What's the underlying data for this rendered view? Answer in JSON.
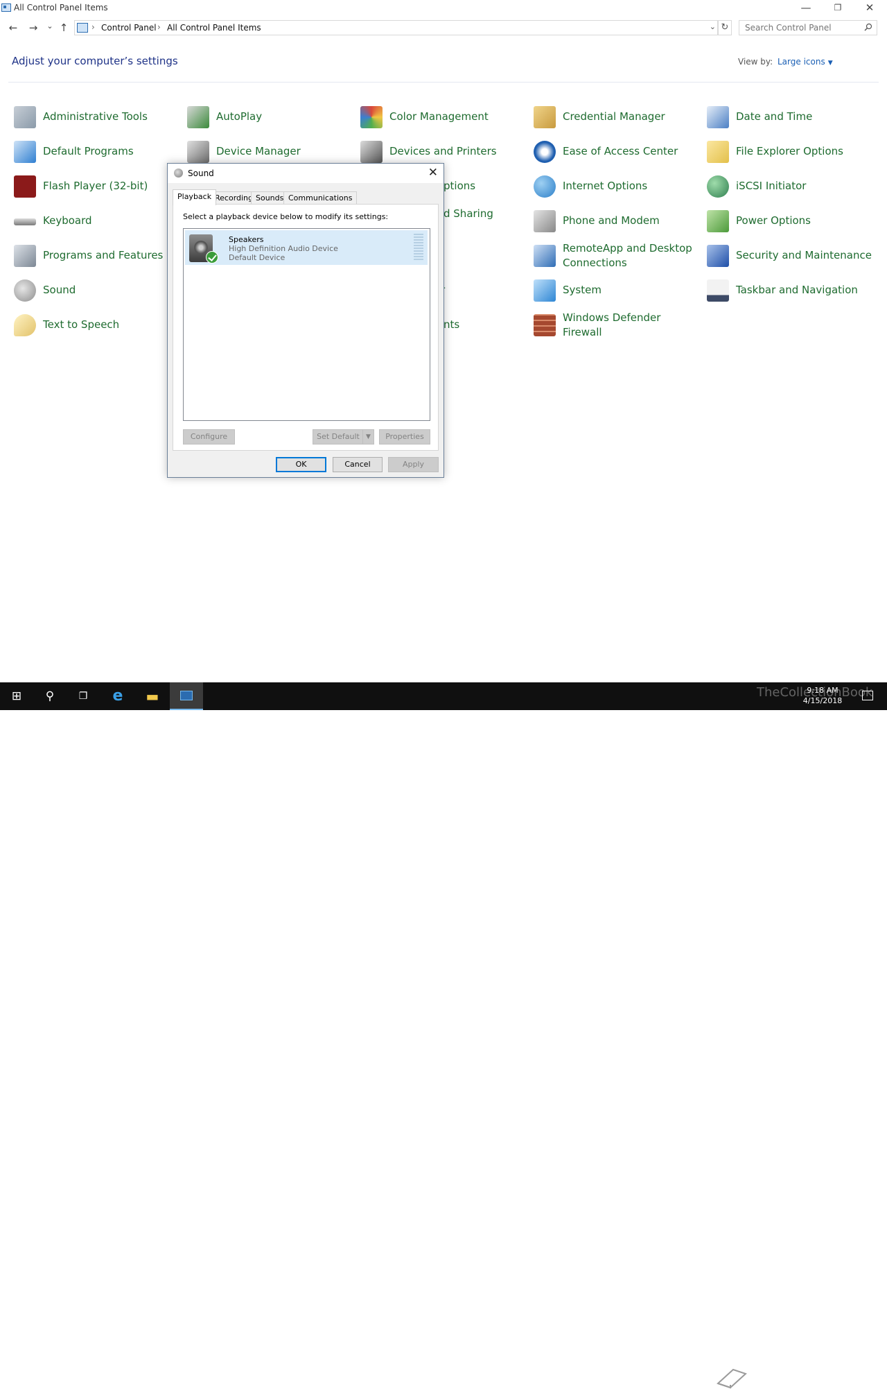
{
  "window": {
    "title": "All Control Panel Items",
    "minimize_glyph": "—",
    "restore_glyph": "❐",
    "close_glyph": "✕"
  },
  "nav": {
    "back_glyph": "←",
    "forward_glyph": "→",
    "recent_glyph": "⌄",
    "up_glyph": "↑",
    "breadcrumb": [
      "Control Panel",
      "All Control Panel Items"
    ],
    "sep_glyph": "›",
    "refresh_glyph": "↻",
    "dropdown_glyph": "⌄"
  },
  "search": {
    "placeholder": "Search Control Panel",
    "icon": "search-icon"
  },
  "header": {
    "title": "Adjust your computer’s settings",
    "view_by_label": "View by:",
    "view_by_value": "Large icons",
    "caret": "▼"
  },
  "items": [
    {
      "label": "Administrative Tools",
      "icon": "admin-tools-icon",
      "color": "#8a9aa9"
    },
    {
      "label": "AutoPlay",
      "icon": "autoplay-icon",
      "color": "#3b8a3b"
    },
    {
      "label": "Color Management",
      "icon": "color-management-icon",
      "color": "#c2553f"
    },
    {
      "label": "Credential Manager",
      "icon": "credential-manager-icon",
      "color": "#c89a3e"
    },
    {
      "label": "Date and Time",
      "icon": "date-time-icon",
      "color": "#4b7fc4"
    },
    {
      "label": "Default Programs",
      "icon": "default-programs-icon",
      "color": "#2f7fd1"
    },
    {
      "label": "Device Manager",
      "icon": "device-manager-icon",
      "color": "#6c6c6c"
    },
    {
      "label": "Devices and Printers",
      "icon": "devices-printers-icon",
      "color": "#555555"
    },
    {
      "label": "Ease of Access Center",
      "icon": "ease-of-access-icon",
      "color": "#1f5fb0"
    },
    {
      "label": "File Explorer Options",
      "icon": "file-explorer-options-icon",
      "color": "#e3c04a"
    },
    {
      "label": "Flash Player (32-bit)",
      "icon": "flash-player-icon",
      "color": "#8b1a1a"
    },
    {
      "label": "ptions",
      "icon": "",
      "color": ""
    },
    {
      "label": "Internet Options",
      "icon": "internet-options-icon",
      "color": "#2c7fc9"
    },
    {
      "label": "iSCSI Initiator",
      "icon": "iscsi-initiator-icon",
      "color": "#2f7f4f"
    },
    {
      "label": "Keyboard",
      "icon": "keyboard-icon",
      "color": "#7a7a7a"
    },
    {
      "label": "d Sharing",
      "icon": "",
      "color": ""
    },
    {
      "label": "Phone and Modem",
      "icon": "phone-modem-icon",
      "color": "#888888"
    },
    {
      "label": "Power Options",
      "icon": "power-options-icon",
      "color": "#4c9a3a"
    },
    {
      "label": "Programs and Features",
      "icon": "programs-features-icon",
      "color": "#7c8794"
    },
    {
      "label": "RemoteApp and Desktop Connections",
      "icon": "remoteapp-icon",
      "color": "#2f6db5"
    },
    {
      "label": "Security and Maintenance",
      "icon": "security-maintenance-icon",
      "color": "#1f4fa8"
    },
    {
      "label": "Sound",
      "icon": "sound-icon",
      "color": "#8c8c8c"
    },
    {
      "label": "r",
      "icon": "",
      "color": ""
    },
    {
      "label": "System",
      "icon": "system-icon",
      "color": "#2e86d4"
    },
    {
      "label": "Taskbar and Navigation",
      "icon": "taskbar-navigation-icon",
      "color": "#3d4a66"
    },
    {
      "label": "Text to Speech",
      "icon": "text-to-speech-icon",
      "color": "#e2c26a"
    },
    {
      "label": "nts",
      "icon": "",
      "color": ""
    },
    {
      "label": "Windows Defender Firewall",
      "icon": "firewall-icon",
      "color": "#a5482f"
    }
  ],
  "dialog": {
    "title": "Sound",
    "close_glyph": "✕",
    "tabs": [
      "Playback",
      "Recording",
      "Sounds",
      "Communications"
    ],
    "prompt": "Select a playback device below to modify its settings:",
    "device": {
      "name": "Speakers",
      "description": "High Definition Audio Device",
      "status": "Default Device"
    },
    "buttons": {
      "configure": "Configure",
      "set_default": "Set Default",
      "split_glyph": "▼",
      "properties": "Properties",
      "ok": "OK",
      "cancel": "Cancel",
      "apply": "Apply"
    }
  },
  "taskbar": {
    "start_glyph": "⊞",
    "search_glyph": "⚲",
    "taskview_glyph": "❐",
    "ie_glyph": "e",
    "explorer_glyph": "▬",
    "time": "9:18 AM",
    "date": "4/15/2018",
    "watermark": "TheCollectionBook",
    "accent": "#76b9ed"
  }
}
